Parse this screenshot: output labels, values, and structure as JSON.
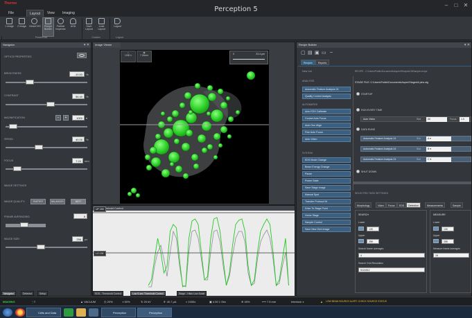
{
  "window": {
    "brand": "Thermo",
    "title": "Perception 5",
    "menu": [
      "File",
      "Layout",
      "View",
      "Imaging"
    ],
    "controls": [
      "minimize-icon",
      "maximize-icon",
      "close-icon"
    ]
  },
  "ribbon": {
    "buttons": [
      {
        "label": "1 Image",
        "icon": "single-image-icon"
      },
      {
        "label": "2 Image",
        "icon": "dual-image-icon"
      },
      {
        "label": "CleanCHS",
        "icon": "clean-icon"
      },
      {
        "label": "Recipe Builder",
        "icon": "recipe-icon"
      },
      {
        "label": "Particle Inspector",
        "icon": "particle-icon"
      },
      {
        "label": "AHA",
        "icon": "aha-icon"
      },
      {
        "label": "Save Layout",
        "icon": "save-layout-icon"
      },
      {
        "label": "Load Layout",
        "icon": "load-layout-icon"
      },
      {
        "label": "Logout",
        "icon": "logout-icon"
      }
    ],
    "groups": [
      "PredefHost",
      "Custom",
      "Logout"
    ]
  },
  "navigator": {
    "title": "Navigator",
    "optics_label": "OPTICS PROPERTIES",
    "brightness": {
      "label": "BRIGHTNESS",
      "value": "-10.53",
      "unit": "%",
      "level": 0.27
    },
    "contrast": {
      "label": "CONTRAST",
      "value": "56.40",
      "unit": "%",
      "level": 0.56
    },
    "magnification": {
      "label": "MAGNIFICATION",
      "value": "1000",
      "level": 0.05
    },
    "speed": {
      "label": "SPEED",
      "value": "40.00",
      "unit": "%",
      "level": 0.4
    },
    "focus": {
      "label": "FOCUS",
      "value": "7.24",
      "unit": "mm",
      "level": 0.1
    },
    "image_settings_label": "IMAGE SETTINGS",
    "image_quality": {
      "label": "IMAGE QUALITY:",
      "options": [
        "FASTEST",
        "BALANCED",
        "BEST"
      ]
    },
    "frame_averaging": {
      "label": "FRAME AVERAGING:",
      "value": "8",
      "level": 0.45
    },
    "image_size": {
      "label": "IMAGE SIZE:",
      "value": "256",
      "unit": "px",
      "level": 0.42
    },
    "bottom_tabs": [
      "Navigator",
      "Detector",
      "Setup"
    ]
  },
  "viewer": {
    "title": "Image Viewer",
    "zoom_label": "1000 x",
    "focus_label": "7.24mm",
    "scale_start": "0",
    "scale_end": "23.4 μm"
  },
  "threshold": {
    "title": "Threshold Control",
    "upper": "255",
    "lower": "130",
    "upper_tag": "UP",
    "lower_tag": "LO",
    "bottom_tabs": [
      "EDS - Threshold Control",
      "Low 5-sec Threshold Control",
      "Stage - Histo Low Scale"
    ]
  },
  "recipe": {
    "title": "Recipe Builder",
    "toolbar_icons": [
      "new-icon",
      "open-icon",
      "save-icon",
      "run-icon",
      "stop-icon"
    ],
    "tabs": [
      "Recipes",
      "Reports"
    ],
    "new_list": "New List",
    "recipe_path": "RECIPE - C:\\Users\\Public\\Documents\\Aspex\\Recipes\\OilSample.recipe",
    "stage_file": "STAGE FILE:   C:\\Users\\Public\\Documents\\Aspex\\Stages\\6 pins.stg",
    "categories": {
      "analysis": "ANALYSIS",
      "automated": "AUTOMATED",
      "system": "SYSTEM"
    },
    "analysis_steps": [
      "Automatic Feature Analysis 24",
      "Quality Control Analysis"
    ],
    "automated_steps": [
      "Auto EDX Calibrate",
      "Course Auto Focus",
      "Auto Gun Align",
      "Fine Auto Focus",
      "Auto Video"
    ],
    "system_steps": [
      "EDS Mode Change",
      "Beam Energy Change",
      "Pause",
      "Power State",
      "Save Stage Image",
      "Manual Spot",
      "Transfer Protocol 94",
      "Drive To Stage Point",
      "Home Stage",
      "Sample Control",
      "Save New Grnt Image"
    ],
    "sections": {
      "startup": "STARTUP",
      "run_every": "RUN EVERY TIME",
      "data_runs": "DATA RUNS",
      "shut_down": "SHUT DOWN"
    },
    "auto_video_row": {
      "label": "Auto Video",
      "slot_label": "Slot",
      "slot": "All",
      "focus_label": "Focus",
      "focus": "1.0"
    },
    "data_rows": [
      {
        "label": "Automatic Feature Analysis 24",
        "slot": "A"
      },
      {
        "label": "Automatic Feature Analysis 24",
        "slot": "B"
      },
      {
        "label": "Automatic Feature Analysis 24",
        "slot": "C"
      }
    ],
    "slot_label": "Slot",
    "task_settings_label": "SELECTED TASK SETTINGS",
    "subtabs": [
      "Morphology",
      "Video",
      "Focus",
      "EDS",
      "Detection",
      "Measurements",
      "Sample"
    ],
    "search": {
      "heading": "SEARCH",
      "lower_label": "Lower",
      "lower": "130",
      "upper_label": "Upper",
      "upper": "255",
      "frames_label": "Search frame averages",
      "frames": "4",
      "grid_label": "Search Grid Resolution",
      "grid": "512x512"
    },
    "measure": {
      "heading": "MEASURE",
      "lower_label": "Lower",
      "lower": "130",
      "upper_label": "Upper",
      "upper": "255",
      "frames_label": "Measure frame averages",
      "frames": "16"
    }
  },
  "status": {
    "mode": "IMAGING",
    "items": [
      "VACUUM",
      "20%",
      "50%",
      "20 kV",
      "40.7 μA",
      "1000x",
      "4.50 1 Sec",
      "40%",
      "7.5 mm",
      "Interlock"
    ],
    "warning": "LOW BEAM SOURCE ALERT: CHECK SOURCE STATUS"
  },
  "taskbar": {
    "apps": [
      "Cells and Data fil...",
      "Perception Group...",
      "Perception"
    ]
  },
  "colors": {
    "accent": "#2e5f86",
    "particle": "#3ee03a",
    "status_bg": "#1d1f22",
    "ok": "#3bd63b",
    "warn": "#f2c230"
  }
}
